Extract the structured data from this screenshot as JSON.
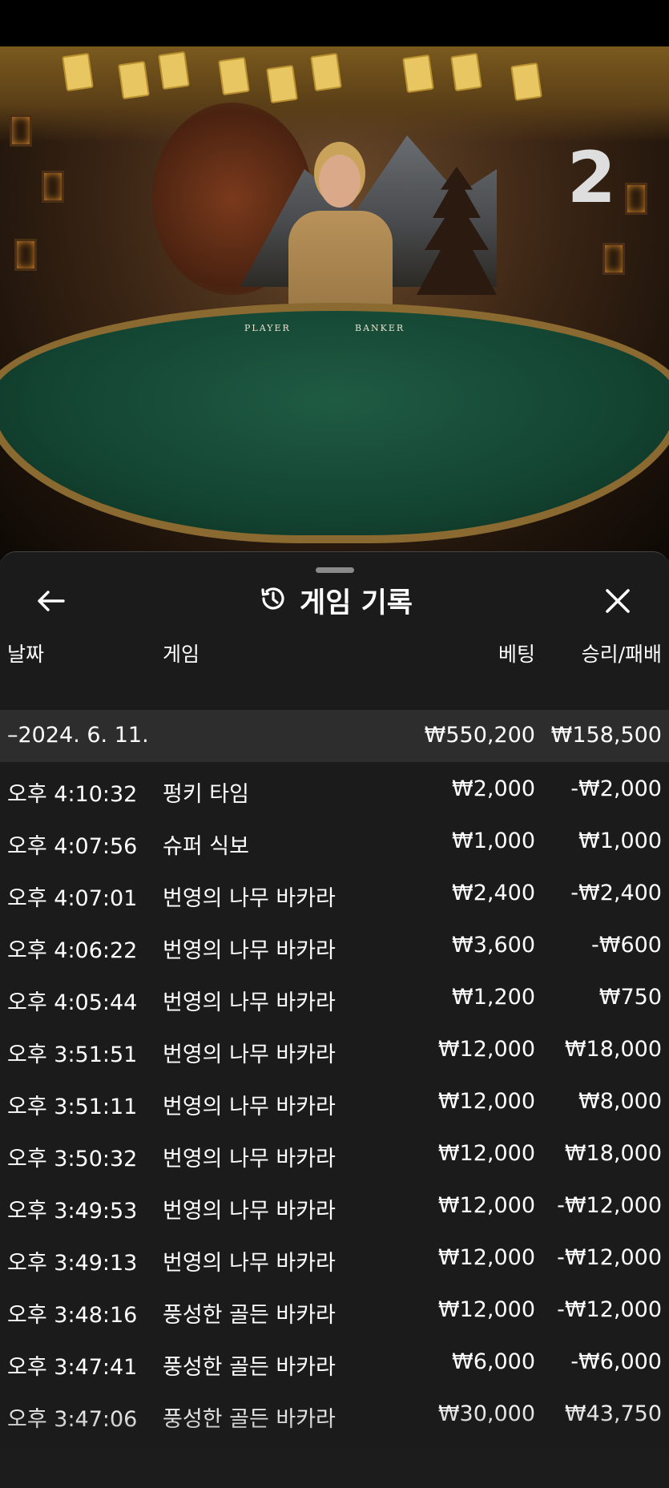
{
  "stream": {
    "round_number": "2",
    "table_labels": {
      "player": "PLAYER",
      "banker": "BANKER"
    }
  },
  "history": {
    "title": "게임 기록",
    "columns": {
      "date": "날짜",
      "game": "게임",
      "bet": "베팅",
      "win_loss": "승리/패배"
    },
    "summary": {
      "date": "–2024. 6. 11.",
      "bet": "₩550,200",
      "win_loss": "₩158,500"
    },
    "rows": [
      {
        "time": "오후 4:10:32",
        "game": "펑키 타임",
        "bet": "₩2,000",
        "result": "-₩2,000"
      },
      {
        "time": "오후 4:07:56",
        "game": "슈퍼 식보",
        "bet": "₩1,000",
        "result": "₩1,000"
      },
      {
        "time": "오후 4:07:01",
        "game": "번영의 나무 바카라",
        "bet": "₩2,400",
        "result": "-₩2,400"
      },
      {
        "time": "오후 4:06:22",
        "game": "번영의 나무 바카라",
        "bet": "₩3,600",
        "result": "-₩600"
      },
      {
        "time": "오후 4:05:44",
        "game": "번영의 나무 바카라",
        "bet": "₩1,200",
        "result": "₩750"
      },
      {
        "time": "오후 3:51:51",
        "game": "번영의 나무 바카라",
        "bet": "₩12,000",
        "result": "₩18,000"
      },
      {
        "time": "오후 3:51:11",
        "game": "번영의 나무 바카라",
        "bet": "₩12,000",
        "result": "₩8,000"
      },
      {
        "time": "오후 3:50:32",
        "game": "번영의 나무 바카라",
        "bet": "₩12,000",
        "result": "₩18,000"
      },
      {
        "time": "오후 3:49:53",
        "game": "번영의 나무 바카라",
        "bet": "₩12,000",
        "result": "-₩12,000"
      },
      {
        "time": "오후 3:49:13",
        "game": "번영의 나무 바카라",
        "bet": "₩12,000",
        "result": "-₩12,000"
      },
      {
        "time": "오후 3:48:16",
        "game": "풍성한 골든 바카라",
        "bet": "₩12,000",
        "result": "-₩12,000"
      },
      {
        "time": "오후 3:47:41",
        "game": "풍성한 골든 바카라",
        "bet": "₩6,000",
        "result": "-₩6,000"
      },
      {
        "time": "오후 3:47:06",
        "game": "풍성한 골든 바카라",
        "bet": "₩30,000",
        "result": "₩43,750"
      }
    ]
  },
  "icons": {
    "back": "arrow-left-icon",
    "history": "history-clock-icon",
    "close": "close-icon"
  },
  "colors": {
    "panel_bg": "#1c1c1c",
    "summary_bg": "#2d2d2d",
    "text": "#ffffff",
    "felt": "#1f5b43"
  }
}
